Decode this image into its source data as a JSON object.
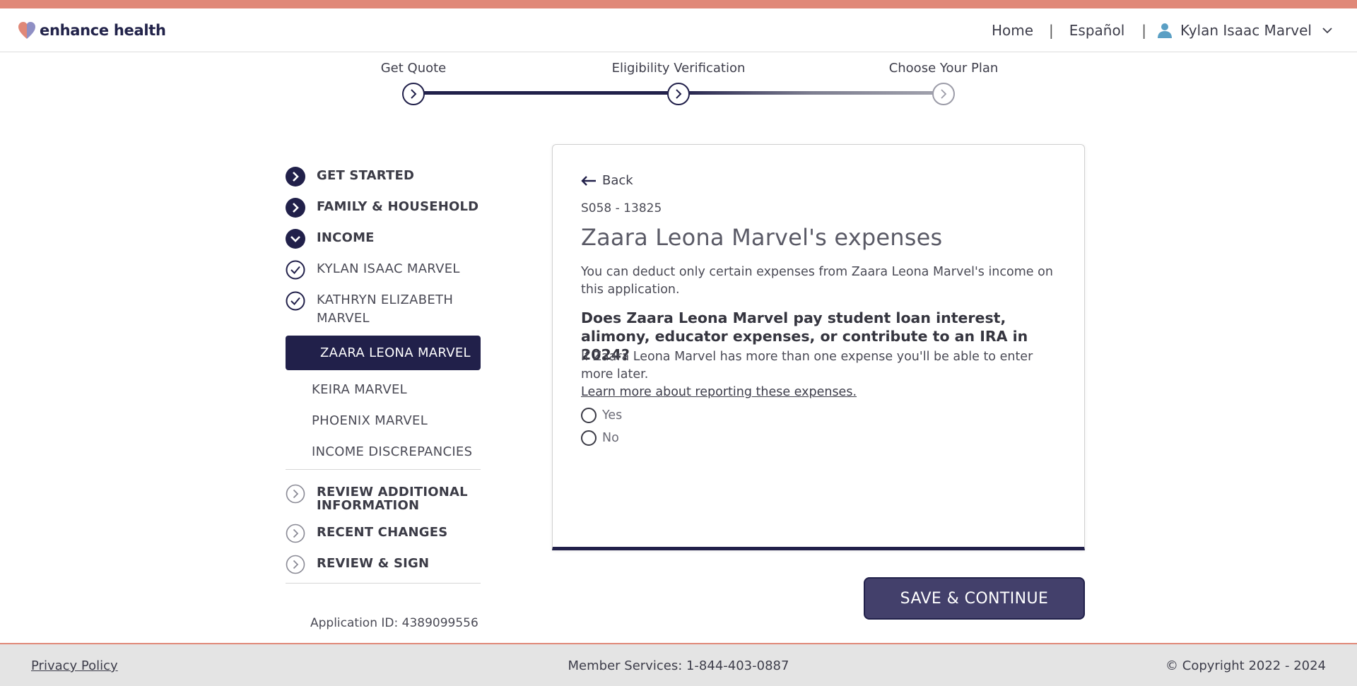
{
  "brand": {
    "name": "enhance health"
  },
  "nav": {
    "home": "Home",
    "separator": "|",
    "language": "Español",
    "user_name": "Kylan Isaac Marvel"
  },
  "stepper": {
    "steps": [
      {
        "label": "Get Quote",
        "state": "complete"
      },
      {
        "label": "Eligibility Verification",
        "state": "current"
      },
      {
        "label": "Choose Your Plan",
        "state": "upcoming"
      }
    ]
  },
  "sidebar": {
    "sections": [
      {
        "label": "GET STARTED",
        "state": "complete"
      },
      {
        "label": "FAMILY & HOUSEHOLD",
        "state": "complete"
      },
      {
        "label": "INCOME",
        "state": "expanded"
      }
    ],
    "income_members": [
      {
        "label": "KYLAN ISAAC MARVEL",
        "state": "checked"
      },
      {
        "label": "KATHRYN ELIZABETH MARVEL",
        "state": "checked"
      },
      {
        "label": "ZAARA LEONA MARVEL",
        "state": "active"
      },
      {
        "label": "KEIRA MARVEL",
        "state": "pending"
      },
      {
        "label": "PHOENIX MARVEL",
        "state": "pending"
      },
      {
        "label": "INCOME DISCREPANCIES",
        "state": "pending"
      }
    ],
    "later_sections": [
      {
        "label": "REVIEW ADDITIONAL INFORMATION"
      },
      {
        "label": "RECENT CHANGES"
      },
      {
        "label": "REVIEW & SIGN"
      }
    ],
    "application_id": "Application ID: 4389099556"
  },
  "card": {
    "back_label": "Back",
    "case_id": "S058 - 13825",
    "title": "Zaara Leona Marvel's expenses",
    "description": "You can deduct only certain expenses from Zaara Leona Marvel's income on this application.",
    "question": "Does Zaara Leona Marvel pay student loan interest, alimony, educator expenses, or contribute to an IRA in 2024?",
    "hint": "If Zaara Leona Marvel has more than one expense you'll be able to enter more later.",
    "learn_more": "Learn more about reporting these expenses.",
    "options": [
      "Yes",
      "No"
    ]
  },
  "actions": {
    "save_continue": "SAVE & CONTINUE"
  },
  "footer": {
    "privacy": "Privacy Policy",
    "member_services": "Member Services: 1-844-403-0887",
    "copyright": "© Copyright 2022 - 2024"
  },
  "colors": {
    "brand_accent": "#e08878",
    "navy": "#21204a",
    "button": "#43406b"
  }
}
